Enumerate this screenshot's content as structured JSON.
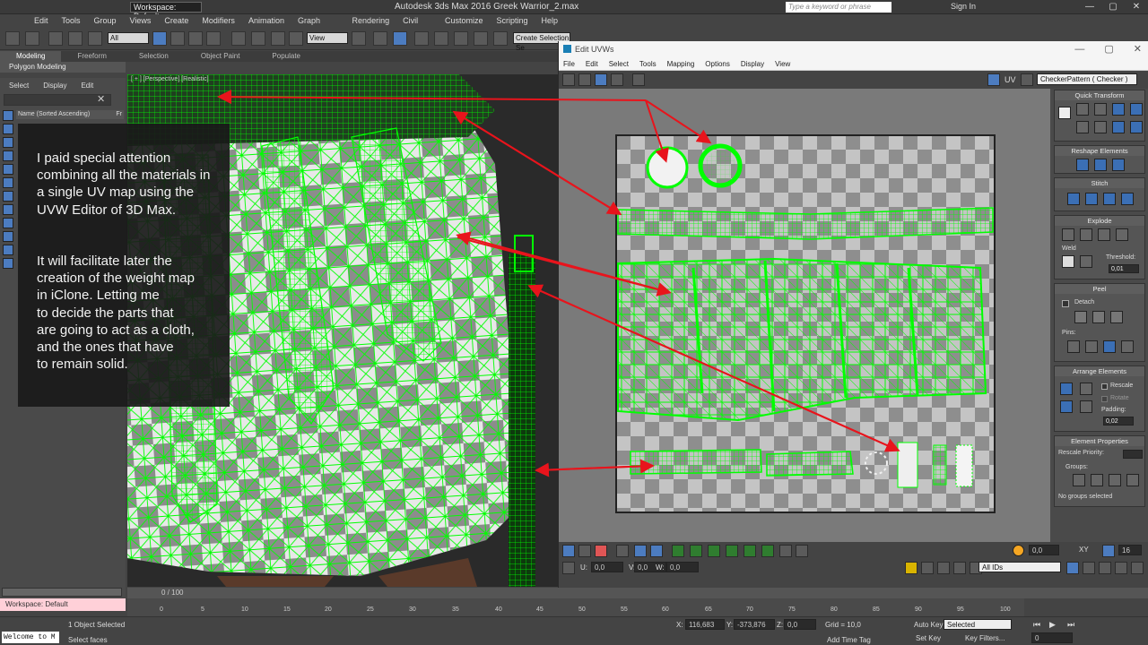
{
  "titlebar": {
    "workspace": "Workspace: Default",
    "title": "Autodesk 3ds Max 2016     Greek Warrior_2.max",
    "search_placeholder": "Type a keyword or phrase",
    "sign_in": "Sign In"
  },
  "menu": [
    "Edit",
    "Tools",
    "Group",
    "Views",
    "Create",
    "Modifiers",
    "Animation",
    "Graph Editors",
    "Rendering",
    "Civil View",
    "Customize",
    "Scripting",
    "Help"
  ],
  "toolbar": {
    "selection_filter": "All",
    "ref_coord": "View",
    "named_selection": "Create Selection Se"
  },
  "ribbon_tabs": [
    "Modeling",
    "Freeform",
    "Selection",
    "Object Paint",
    "Populate"
  ],
  "ribbon_active": "Modeling",
  "polygon_modeling": "Polygon Modeling",
  "explorer": {
    "tabs": [
      "Select",
      "Display",
      "Edit"
    ],
    "column_header": "Name (Sorted Ascending)",
    "column_header2": "Fr"
  },
  "viewport": {
    "label": "[ + ] [Perspective] [Realistic]"
  },
  "callout": {
    "para1": "I paid special attention\ncombining all the materials in\na single UV map using the\nUVW Editor of 3D Max.",
    "para2": "It will facilitate later the\ncreation of the weight map\nin iClone. Letting me\nto decide the parts that\nare going to act as a cloth,\nand the ones that have\nto remain solid."
  },
  "uv_editor": {
    "title": "Edit UVWs",
    "menu": [
      "File",
      "Edit",
      "Select",
      "Tools",
      "Mapping",
      "Options",
      "Display",
      "View"
    ],
    "uv_label": "UV",
    "texture_combo": "CheckerPattern  ( Checker )",
    "panel": {
      "quick_transform": "Quick Transform",
      "reshape_elements": "Reshape Elements",
      "stitch": "Stitch",
      "explode": "Explode",
      "weld": "Weld",
      "threshold_label": "Threshold:",
      "threshold_value": "0,01",
      "peel": "Peel",
      "detach": "Detach",
      "pins": "Pins:",
      "arrange_elements": "Arrange Elements",
      "rescale": "Rescale",
      "rotate": "Rotate",
      "padding_label": "Padding:",
      "padding_value": "0,02",
      "element_properties": "Element Properties",
      "rescale_priority": "Rescale Priority:",
      "groups": "Groups:",
      "no_groups": "No groups selected"
    },
    "bottom": {
      "u_label": "U:",
      "u_value": "0,0",
      "v_label": "V:",
      "v_value": "0,0",
      "w_label": "W:",
      "w_value": "0,0",
      "angle_value": "0,0",
      "xy_label": "XY",
      "zoom_value": "16",
      "ids_combo": "All IDs"
    }
  },
  "timeline": {
    "frame": "0 / 100",
    "ticks": [
      "0",
      "5",
      "10",
      "15",
      "20",
      "25",
      "30",
      "35",
      "40",
      "45",
      "50",
      "55",
      "60",
      "65",
      "70",
      "75",
      "80",
      "85",
      "90",
      "95",
      "100"
    ]
  },
  "status": {
    "workspace": "Workspace: Default",
    "welcome": "Welcome to M",
    "objects_selected": "1 Object Selected",
    "prompt": "Select faces",
    "x_label": "X:",
    "x_value": "116,683",
    "y_label": "Y:",
    "y_value": "-373,876",
    "z_label": "Z:",
    "z_value": "0,0",
    "grid": "Grid = 10,0",
    "add_time_tag": "Add Time Tag",
    "auto_key": "Auto Key",
    "selected": "Selected",
    "set_key": "Set Key",
    "key_filters": "Key Filters...",
    "frame_value": "0"
  },
  "colors": {
    "wire_green": "#00ff00",
    "arrow_red": "#e8141c",
    "uv_accent": "#3b6fb5"
  }
}
